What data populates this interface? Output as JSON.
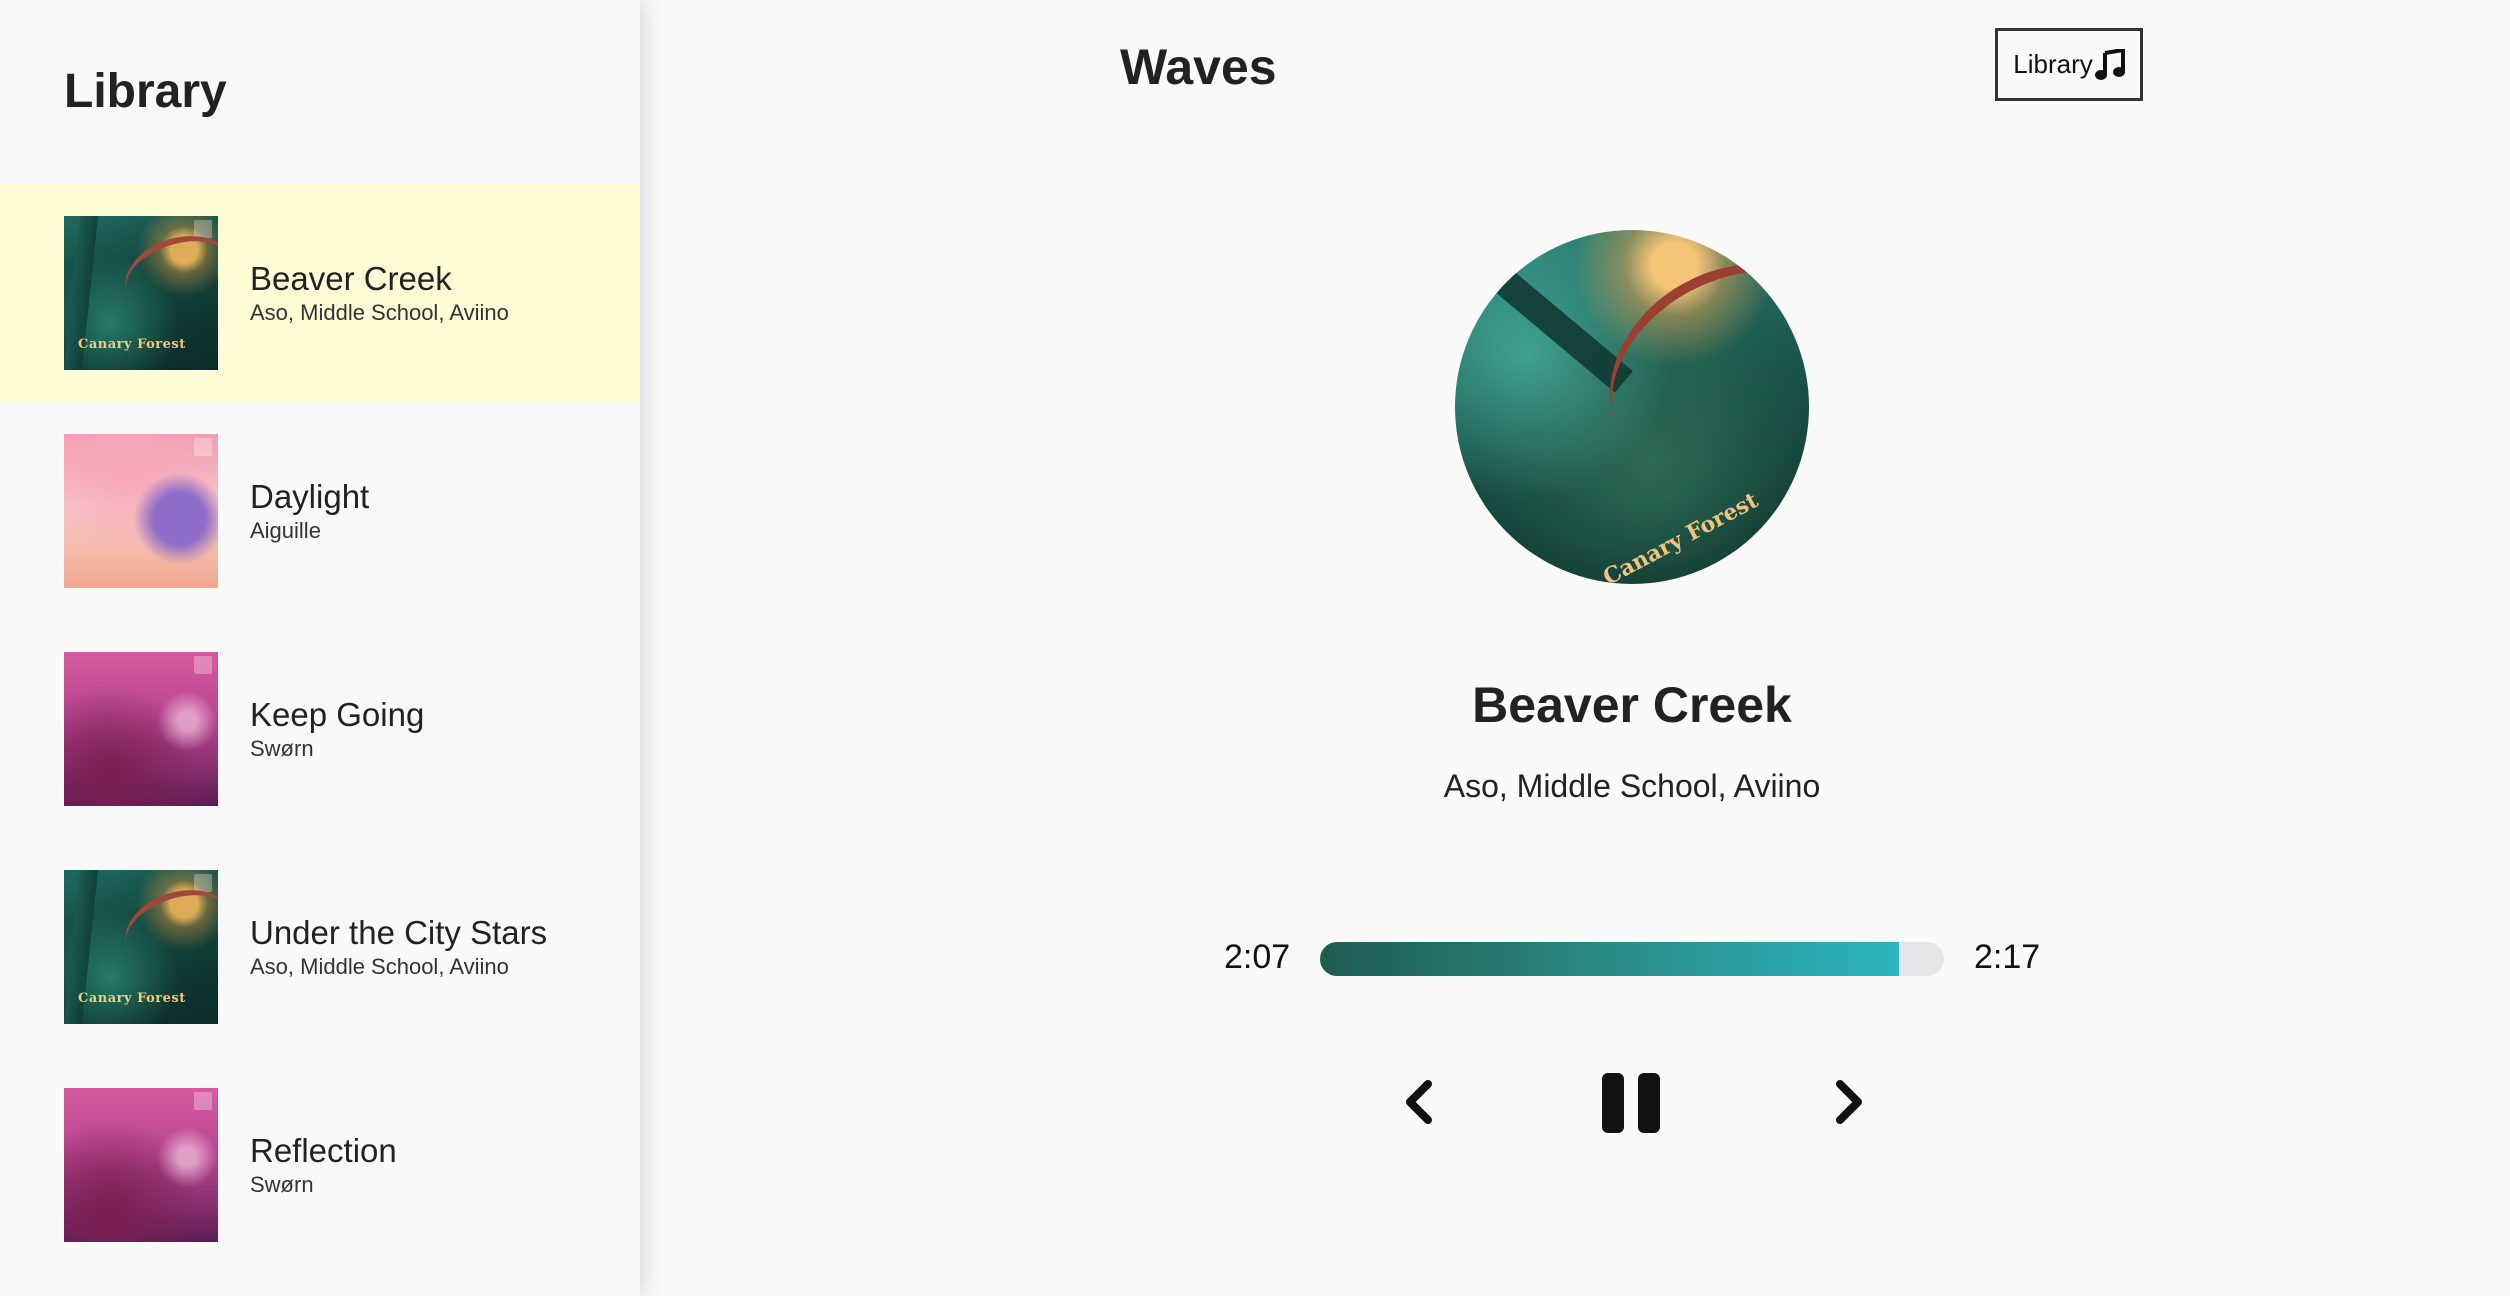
{
  "sidebar": {
    "title": "Library",
    "songs": [
      {
        "title": "Beaver Creek",
        "artist": "Aso, Middle School, Aviino",
        "cover": "canary",
        "caption": "Canary Forest",
        "active": true
      },
      {
        "title": "Daylight",
        "artist": "Aiguille",
        "cover": "daylight",
        "caption": "",
        "active": false
      },
      {
        "title": "Keep Going",
        "artist": "Swørn",
        "cover": "sworn",
        "caption": "",
        "active": false
      },
      {
        "title": "Under the City Stars",
        "artist": "Aso, Middle School, Aviino",
        "cover": "canary",
        "caption": "Canary Forest",
        "active": false
      },
      {
        "title": "Reflection",
        "artist": "Swørn",
        "cover": "sworn",
        "caption": "",
        "active": false
      }
    ]
  },
  "header": {
    "app_title": "Waves",
    "library_button": "Library",
    "library_icon": "music-note-icon"
  },
  "player": {
    "cover_caption": "Canary Forest",
    "title": "Beaver Creek",
    "artist": "Aso, Middle School, Aviino",
    "current_time": "2:07",
    "total_time": "2:17",
    "progress_fraction": 0.928,
    "controls": {
      "prev_icon": "chevron-left-icon",
      "play_icon": "pause-icon",
      "next_icon": "chevron-right-icon"
    }
  },
  "colors": {
    "active_row": "#fefdd6",
    "progress_start": "#1e5b50",
    "progress_end": "#2bb5bf",
    "progress_track": "#e3e5e6"
  }
}
